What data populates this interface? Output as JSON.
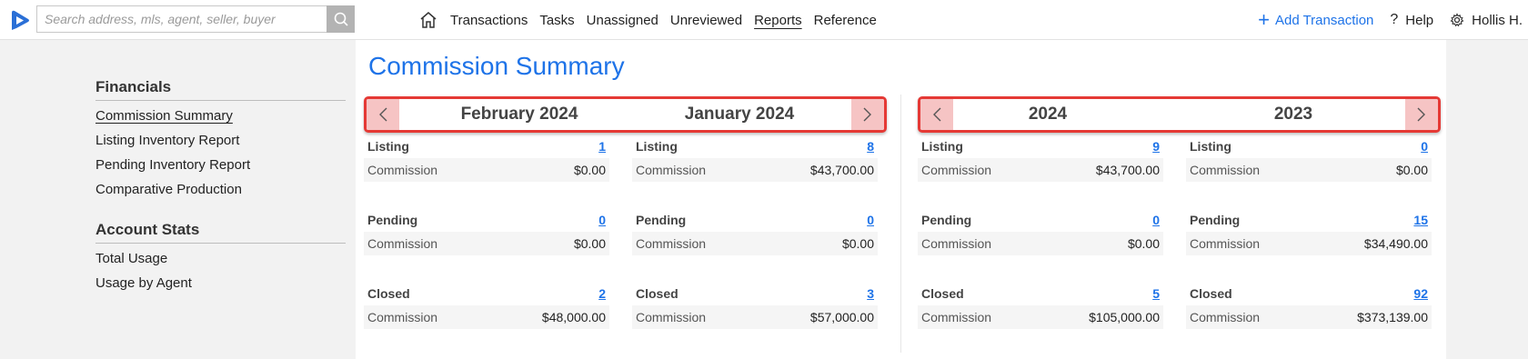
{
  "search": {
    "placeholder": "Search address, mls, agent, seller, buyer"
  },
  "nav": {
    "items": [
      "Transactions",
      "Tasks",
      "Unassigned",
      "Unreviewed",
      "Reports",
      "Reference"
    ],
    "add_transaction": "Add Transaction",
    "help": "Help",
    "user": "Hollis H."
  },
  "sidebar": {
    "financials_heading": "Financials",
    "financials": [
      "Commission Summary",
      "Listing Inventory Report",
      "Pending Inventory Report",
      "Comparative Production"
    ],
    "account_heading": "Account Stats",
    "account": [
      "Total Usage",
      "Usage by Agent"
    ]
  },
  "main": {
    "title": "Commission Summary",
    "monthly": {
      "periods": [
        "February 2024",
        "January 2024"
      ],
      "columns": [
        {
          "listing_label": "Listing",
          "listing_count": "1",
          "listing_commission_label": "Commission",
          "listing_commission": "$0.00",
          "pending_label": "Pending",
          "pending_count": "0",
          "pending_commission_label": "Commission",
          "pending_commission": "$0.00",
          "closed_label": "Closed",
          "closed_count": "2",
          "closed_commission_label": "Commission",
          "closed_commission": "$48,000.00"
        },
        {
          "listing_label": "Listing",
          "listing_count": "8",
          "listing_commission_label": "Commission",
          "listing_commission": "$43,700.00",
          "pending_label": "Pending",
          "pending_count": "0",
          "pending_commission_label": "Commission",
          "pending_commission": "$0.00",
          "closed_label": "Closed",
          "closed_count": "3",
          "closed_commission_label": "Commission",
          "closed_commission": "$57,000.00"
        }
      ]
    },
    "yearly": {
      "periods": [
        "2024",
        "2023"
      ],
      "columns": [
        {
          "listing_label": "Listing",
          "listing_count": "9",
          "listing_commission_label": "Commission",
          "listing_commission": "$43,700.00",
          "pending_label": "Pending",
          "pending_count": "0",
          "pending_commission_label": "Commission",
          "pending_commission": "$0.00",
          "closed_label": "Closed",
          "closed_count": "5",
          "closed_commission_label": "Commission",
          "closed_commission": "$105,000.00"
        },
        {
          "listing_label": "Listing",
          "listing_count": "0",
          "listing_commission_label": "Commission",
          "listing_commission": "$0.00",
          "pending_label": "Pending",
          "pending_count": "15",
          "pending_commission_label": "Commission",
          "pending_commission": "$34,490.00",
          "closed_label": "Closed",
          "closed_count": "92",
          "closed_commission_label": "Commission",
          "closed_commission": "$373,139.00"
        }
      ]
    }
  },
  "colors": {
    "accent": "#1e73e8",
    "highlight_border": "#e53935",
    "arrow_bg": "#f6c4c4"
  }
}
